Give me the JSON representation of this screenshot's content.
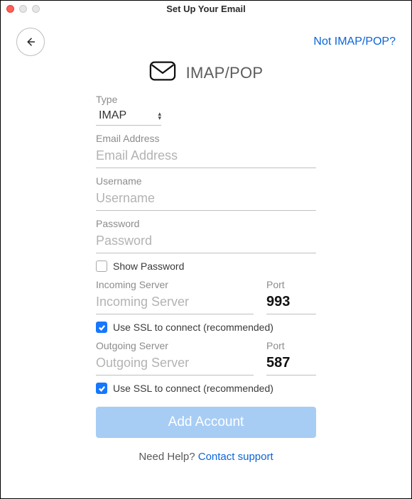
{
  "window": {
    "title": "Set Up Your Email"
  },
  "top": {
    "not_imap_pop": "Not IMAP/POP?"
  },
  "header": {
    "protocol_heading": "IMAP/POP"
  },
  "form": {
    "type_label": "Type",
    "type_value": "IMAP",
    "email_label": "Email Address",
    "email_placeholder": "Email Address",
    "email_value": "",
    "username_label": "Username",
    "username_placeholder": "Username",
    "username_value": "",
    "password_label": "Password",
    "password_placeholder": "Password",
    "password_value": "",
    "show_password_label": "Show Password",
    "incoming_label": "Incoming Server",
    "incoming_placeholder": "Incoming Server",
    "incoming_value": "",
    "port_label": "Port",
    "incoming_port": "993",
    "ssl_label": "Use SSL to connect (recommended)",
    "outgoing_label": "Outgoing Server",
    "outgoing_placeholder": "Outgoing Server",
    "outgoing_value": "",
    "outgoing_port": "587",
    "add_button": "Add Account"
  },
  "footer": {
    "need_help": "Need Help? ",
    "contact_support": "Contact support"
  }
}
